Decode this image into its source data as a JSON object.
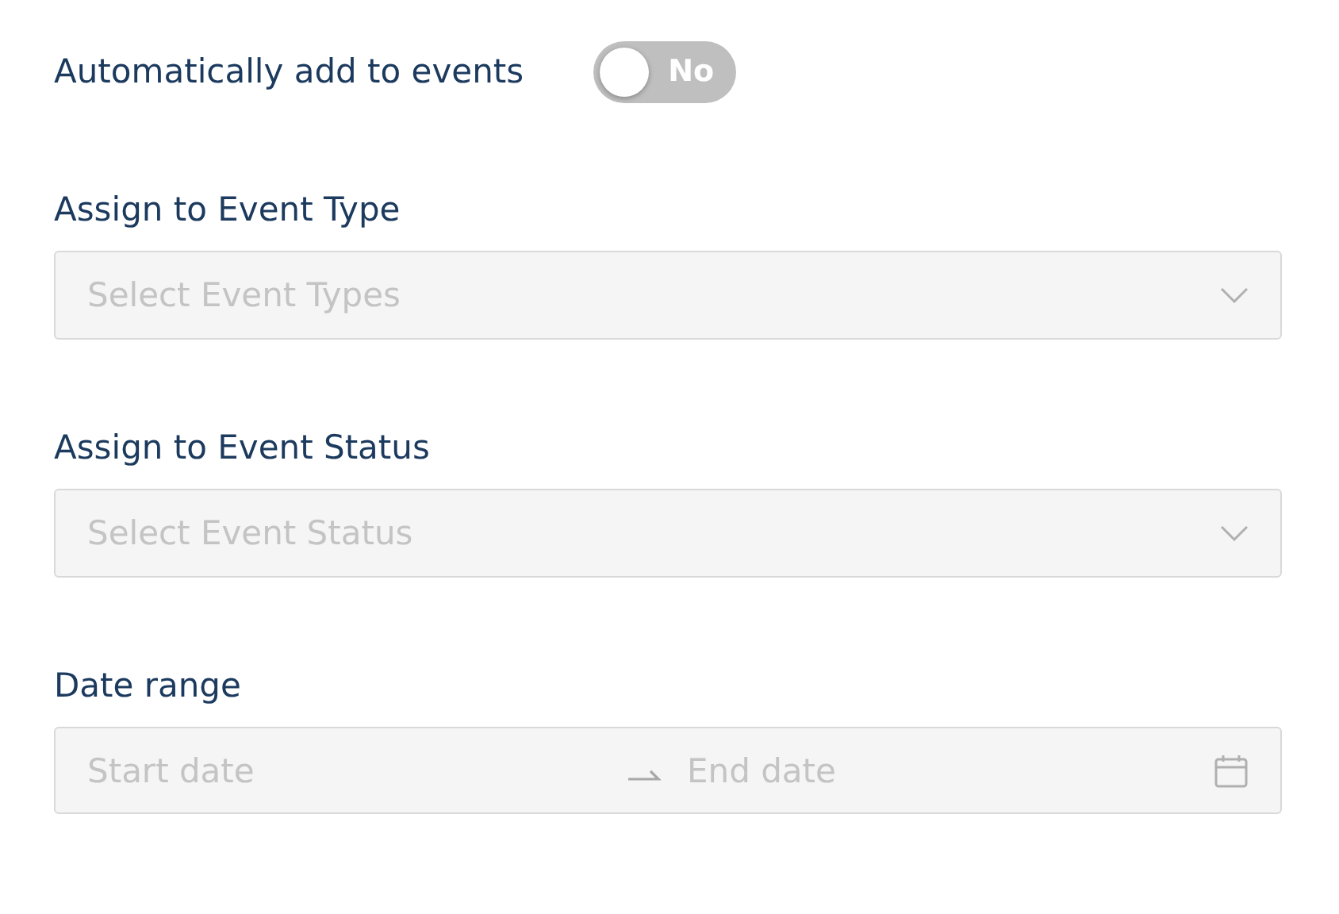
{
  "auto_add": {
    "label": "Automatically add to events",
    "on": false,
    "state_text": "No"
  },
  "event_type": {
    "label": "Assign to Event Type",
    "placeholder": "Select Event Types"
  },
  "event_status": {
    "label": "Assign to Event Status",
    "placeholder": "Select Event Status"
  },
  "date_range": {
    "label": "Date range",
    "start_placeholder": "Start date",
    "end_placeholder": "End date"
  }
}
